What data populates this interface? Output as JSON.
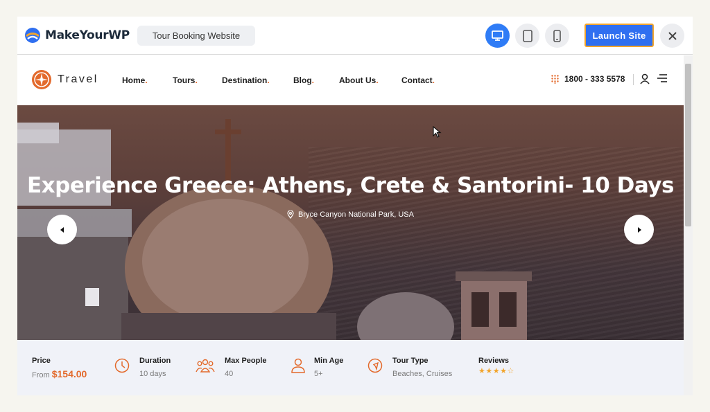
{
  "builder": {
    "brand": "MakeYourWP",
    "project_name": "Tour Booking Website",
    "devices": [
      "desktop-icon",
      "tablet-icon",
      "mobile-icon"
    ],
    "launch_label": "Launch Site",
    "colors": {
      "accent": "#2f6ff0",
      "highlight": "#f2a52c"
    }
  },
  "site": {
    "logo_text": "Travel",
    "nav": [
      {
        "label": "Home"
      },
      {
        "label": "Tours"
      },
      {
        "label": "Destination"
      },
      {
        "label": "Blog"
      },
      {
        "label": "About Us"
      },
      {
        "label": "Contact"
      }
    ],
    "nav_dot": ".",
    "phone": "1800 - 333 5578",
    "accent_color": "#e36a2c"
  },
  "hero": {
    "title": "Experience Greece: Athens, Crete & Santorini- 10 Days",
    "location": "Bryce Canyon National Park, USA"
  },
  "tour_info": {
    "price": {
      "label": "Price",
      "prefix": "From",
      "amount": "$154.00"
    },
    "duration": {
      "label": "Duration",
      "value": "10 days"
    },
    "max_people": {
      "label": "Max People",
      "value": "40"
    },
    "min_age": {
      "label": "Min Age",
      "value": "5+"
    },
    "tour_type": {
      "label": "Tour Type",
      "value": "Beaches, Cruises"
    },
    "reviews": {
      "label": "Reviews",
      "rating": 4,
      "max": 5,
      "stars": "★★★★☆"
    }
  }
}
